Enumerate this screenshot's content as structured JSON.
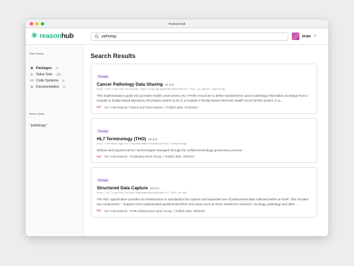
{
  "window": {
    "title": "ReasonHub"
  },
  "header": {
    "logo_text_a": "reason",
    "logo_text_b": "hub",
    "logo_icon": "asterisk-icon",
    "search_value": "pathology",
    "user_name": "brian"
  },
  "sidebar": {
    "filter_heading": "Filter Results",
    "items": [
      {
        "icon": "package-icon",
        "label": "Packages",
        "count": "4"
      },
      {
        "icon": "value-sets-icon",
        "label": "Value Sets",
        "count": "100"
      },
      {
        "icon": "code-icon",
        "label": "Code Systems",
        "count": "9"
      },
      {
        "icon": "documentation-icon",
        "label": "Documentation",
        "count": "0"
      }
    ],
    "query_heading": "Search Query",
    "query_value": "\"pathology\""
  },
  "main": {
    "heading": "Search Results",
    "results": [
      {
        "badge": "Package",
        "title": "Cancer Pathology Data Sharing",
        "version": "v2.0.0",
        "url": "http://hl7.org/fhir/us/cancer-reporting/ImplementationGuide/hl7.fhir.us.cancer-reporting",
        "description": "This implementation guide (IG) provides Health Level Seven (HL7 FHIR) resources to define standards for cancer pathology information exchange from a hospital or facility-based laboratory information system (LIS) to a hospital or facility-based electronic health record (EHR) system or to...",
        "publisher_mark": "HL7",
        "meta": "HL7 International / Orders and Observations",
        "publish_date": "Publish date: 10/3/2023"
      },
      {
        "badge": "Package",
        "title": "HL7 Terminology (THO)",
        "version": "v5.5.0",
        "url": "http://terminology.hl7.org/ImplementationGuide/hl7.terminology",
        "description": "Defines and exposes all HL7 terminologies managed through the unified terminology governance process",
        "publisher_mark": "HL7",
        "meta": "HL7 International - Vocabulary Work Group",
        "publish_date": "Publish date: 3/9/2024"
      },
      {
        "badge": "Package",
        "title": "Structured Data Capture",
        "version": "v3.0.0",
        "url": "http://hl7.org/fhir/uv/sdc/ImplementationGuide/hl7.fhir.uv.sdc",
        "description": "The SDC specification provides an infrastructure to standardize the capture and expanded use of patient-level data collected within an EHR. This includes two components: * Support more sophisticated questionnaire/form use-cases such as those needed for research, oncology, pathology and other...",
        "publisher_mark": "HL7",
        "meta": "HL7 International - FHIR Infrastructure Work Group",
        "publish_date": "Publish date: 3/8/2022"
      }
    ]
  }
}
